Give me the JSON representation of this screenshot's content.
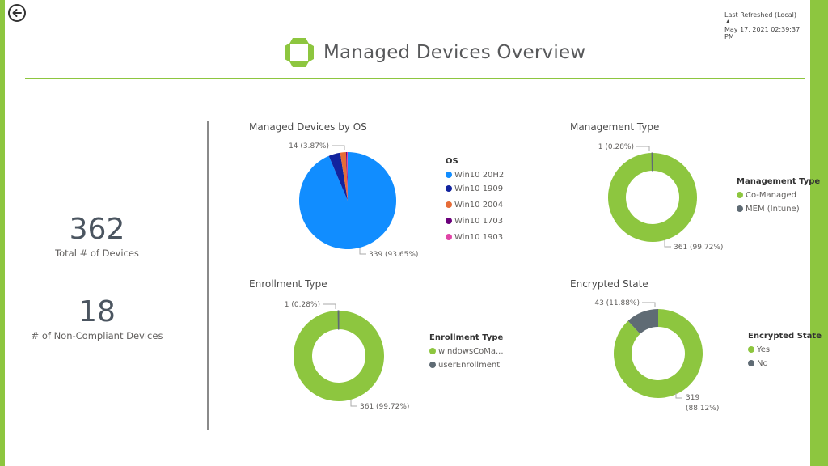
{
  "header": {
    "title": "Managed Devices Overview",
    "last_refreshed_label": "Last Refreshed (Local)",
    "last_refreshed_value": "May 17, 2021 02:39:37 PM",
    "back_icon": "back-arrow-circle-icon",
    "logo_icon": "four-segment-logo-icon"
  },
  "colors": {
    "accent": "#8dc63f",
    "gray": "#5f6b74"
  },
  "kpis": [
    {
      "value": "362",
      "label": "Total # of Devices"
    },
    {
      "value": "18",
      "label": "# of Non-Compliant Devices"
    }
  ],
  "chart_data": [
    {
      "type": "pie",
      "title": "Managed Devices by OS",
      "legend_title": "OS",
      "legend_position": "right",
      "categories": [
        "Win10 20H2",
        "Win10 1909",
        "Win10 2004",
        "Win10 1703",
        "Win10 1903"
      ],
      "values": [
        339,
        14,
        7,
        1,
        1
      ],
      "colors": [
        "#118dff",
        "#12239e",
        "#e66c37",
        "#6b007b",
        "#e044a7"
      ],
      "data_labels": [
        "339 (93.65%)",
        "14 (3.87%)",
        "",
        "",
        ""
      ]
    },
    {
      "type": "pie",
      "donut": true,
      "title": "Management Type",
      "legend_title": "Management Type",
      "legend_position": "right",
      "categories": [
        "Co-Managed",
        "MEM (Intune)"
      ],
      "values": [
        361,
        1
      ],
      "colors": [
        "#8dc63f",
        "#5f6b74"
      ],
      "data_labels": [
        "361 (99.72%)",
        "1 (0.28%)"
      ]
    },
    {
      "type": "pie",
      "donut": true,
      "title": "Enrollment Type",
      "legend_title": "Enrollment Type",
      "legend_position": "right",
      "categories": [
        "windowsCoMa...",
        "userEnrollment"
      ],
      "values": [
        361,
        1
      ],
      "colors": [
        "#8dc63f",
        "#5f6b74"
      ],
      "data_labels": [
        "361 (99.72%)",
        "1 (0.28%)"
      ]
    },
    {
      "type": "pie",
      "donut": true,
      "title": "Encrypted State",
      "legend_title": "Encrypted State",
      "legend_position": "right",
      "categories": [
        "Yes",
        "No"
      ],
      "values": [
        319,
        43
      ],
      "colors": [
        "#8dc63f",
        "#5f6b74"
      ],
      "data_labels": [
        "319 (88.12%)",
        "43 (11.88%)"
      ]
    }
  ]
}
